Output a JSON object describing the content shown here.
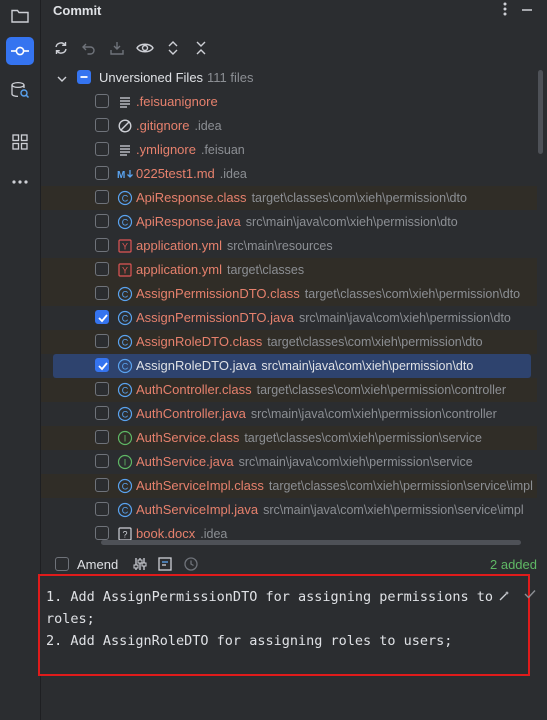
{
  "header": {
    "title": "Commit"
  },
  "tree": {
    "group_label": "Unversioned Files",
    "group_count": "111 files"
  },
  "files": [
    {
      "name": ".feisuanignore",
      "path": "",
      "icon": "text-lines-icon",
      "checked": false,
      "tint": false,
      "red": true
    },
    {
      "name": ".gitignore",
      "path": ".idea",
      "icon": "ignore-icon",
      "checked": false,
      "tint": false,
      "red": true
    },
    {
      "name": ".ymlignore",
      "path": ".feisuan",
      "icon": "text-lines-icon",
      "checked": false,
      "tint": false,
      "red": true
    },
    {
      "name": "0225test1.md",
      "path": ".idea",
      "icon": "markdown-icon",
      "checked": false,
      "tint": false,
      "red": true
    },
    {
      "name": "ApiResponse.class",
      "path": "target\\classes\\com\\xieh\\permission\\dto",
      "icon": "class-icon",
      "checked": false,
      "tint": true,
      "red": true
    },
    {
      "name": "ApiResponse.java",
      "path": "src\\main\\java\\com\\xieh\\permission\\dto",
      "icon": "class-icon",
      "checked": false,
      "tint": false,
      "red": true
    },
    {
      "name": "application.yml",
      "path": "src\\main\\resources",
      "icon": "yaml-icon",
      "checked": false,
      "tint": false,
      "red": true
    },
    {
      "name": "application.yml",
      "path": "target\\classes",
      "icon": "yaml-icon",
      "checked": false,
      "tint": true,
      "red": true
    },
    {
      "name": "AssignPermissionDTO.class",
      "path": "target\\classes\\com\\xieh\\permission\\dto",
      "icon": "class-icon",
      "checked": false,
      "tint": true,
      "red": true
    },
    {
      "name": "AssignPermissionDTO.java",
      "path": "src\\main\\java\\com\\xieh\\permission\\dto",
      "icon": "class-icon",
      "checked": true,
      "tint": false,
      "red": true
    },
    {
      "name": "AssignRoleDTO.class",
      "path": "target\\classes\\com\\xieh\\permission\\dto",
      "icon": "class-icon",
      "checked": false,
      "tint": true,
      "red": true
    },
    {
      "name": "AssignRoleDTO.java",
      "path": "src\\main\\java\\com\\xieh\\permission\\dto",
      "icon": "class-icon",
      "checked": true,
      "tint": false,
      "red": false,
      "selected": true
    },
    {
      "name": "AuthController.class",
      "path": "target\\classes\\com\\xieh\\permission\\controller",
      "icon": "class-icon",
      "checked": false,
      "tint": true,
      "red": true
    },
    {
      "name": "AuthController.java",
      "path": "src\\main\\java\\com\\xieh\\permission\\controller",
      "icon": "class-icon",
      "checked": false,
      "tint": false,
      "red": true
    },
    {
      "name": "AuthService.class",
      "path": "target\\classes\\com\\xieh\\permission\\service",
      "icon": "interface-icon",
      "checked": false,
      "tint": true,
      "red": true
    },
    {
      "name": "AuthService.java",
      "path": "src\\main\\java\\com\\xieh\\permission\\service",
      "icon": "interface-icon",
      "checked": false,
      "tint": false,
      "red": true
    },
    {
      "name": "AuthServiceImpl.class",
      "path": "target\\classes\\com\\xieh\\permission\\service\\impl",
      "icon": "class-icon",
      "checked": false,
      "tint": true,
      "red": true
    },
    {
      "name": "AuthServiceImpl.java",
      "path": "src\\main\\java\\com\\xieh\\permission\\service\\impl",
      "icon": "class-icon",
      "checked": false,
      "tint": false,
      "red": true
    },
    {
      "name": "book.docx",
      "path": ".idea",
      "icon": "unknown-file-icon",
      "checked": false,
      "tint": false,
      "red": true
    }
  ],
  "amend": {
    "label": "Amend",
    "status": "2 added"
  },
  "commit_message": {
    "line1": "1. Add AssignPermissionDTO for assigning permissions to",
    "line2": "roles;",
    "line3": "2. Add AssignRoleDTO for assigning roles to users;"
  },
  "colors": {
    "accent": "#3574f0",
    "unversioned": "#e6816d",
    "added": "#5fb865",
    "highlight_border": "#e01b1b"
  }
}
